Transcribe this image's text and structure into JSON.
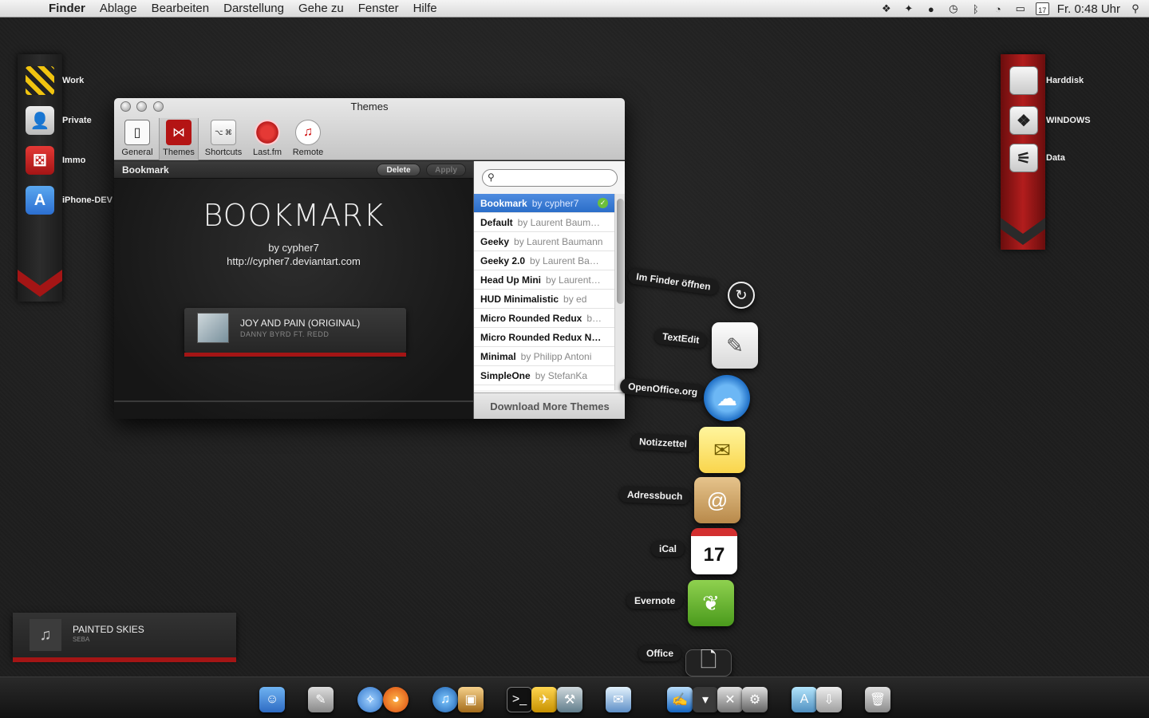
{
  "menubar": {
    "app": "Finder",
    "items": [
      "Ablage",
      "Bearbeiten",
      "Darstellung",
      "Gehe zu",
      "Fenster",
      "Hilfe"
    ],
    "calendar_day": "17",
    "clock": "Fr. 0:48 Uhr"
  },
  "left_shortcuts": [
    {
      "label": "Work",
      "icon": "hazard-stripes-icon"
    },
    {
      "label": "Private",
      "icon": "person-icon"
    },
    {
      "label": "Immo",
      "icon": "dice-icon"
    },
    {
      "label": "iPhone-DEV",
      "icon": "app-store-icon"
    }
  ],
  "right_shortcuts": [
    {
      "label": "Harddisk",
      "icon": "apple-disk-icon"
    },
    {
      "label": "WINDOWS",
      "icon": "windows-disk-icon"
    },
    {
      "label": "Data",
      "icon": "usb-disk-icon"
    }
  ],
  "themes_window": {
    "title": "Themes",
    "toolbar": [
      "General",
      "Themes",
      "Shortcuts",
      "Last.fm",
      "Remote"
    ],
    "selected_tab": "Themes",
    "preview_name": "Bookmark",
    "delete_label": "Delete",
    "apply_label": "Apply",
    "preview": {
      "big_title": "BOOKMARK",
      "by_line": "by cypher7",
      "url": "http://cypher7.deviantart.com",
      "track": "JOY AND PAIN (ORIGINAL)",
      "artist": "DANNY BYRD FT. REDD"
    },
    "search_placeholder": "",
    "themes": [
      {
        "name": "Bookmark",
        "author": "by cypher7",
        "selected": true
      },
      {
        "name": "Default",
        "author": "by Laurent Baum…"
      },
      {
        "name": "Geeky",
        "author": "by Laurent Baumann"
      },
      {
        "name": "Geeky 2.0",
        "author": "by Laurent Ba…"
      },
      {
        "name": "Head Up Mini",
        "author": "by Laurent…"
      },
      {
        "name": "HUD Minimalistic",
        "author": "by ed"
      },
      {
        "name": "Micro Rounded Redux",
        "author": "b…"
      },
      {
        "name": "Micro Rounded Redux N…",
        "author": ""
      },
      {
        "name": "Minimal",
        "author": "by Philipp Antoni"
      },
      {
        "name": "SimpleOne",
        "author": "by StefanKa"
      }
    ],
    "download_label": "Download More Themes"
  },
  "stack": [
    {
      "label": "Im Finder öffnen"
    },
    {
      "label": "TextEdit"
    },
    {
      "label": "OpenOffice.org"
    },
    {
      "label": "Notizzettel"
    },
    {
      "label": "Adressbuch"
    },
    {
      "label": "iCal",
      "day": "17"
    },
    {
      "label": "Evernote"
    },
    {
      "label": "Office"
    }
  ],
  "now_playing": {
    "track": "PAINTED SKIES",
    "artist": "SEBA"
  },
  "dock": [
    "Finder",
    "Preview",
    "Safari",
    "Firefox",
    "iTunes",
    "iPhoto",
    "Terminal",
    "Cyberduck",
    "Xcode",
    "Mail",
    "Pages",
    "Downloads menu",
    "Utility",
    "Disk Utility",
    "Applications",
    "Downloads",
    "Trash"
  ],
  "colors": {
    "accent_red": "#a41515",
    "selection_blue": "#2b6ec9"
  }
}
